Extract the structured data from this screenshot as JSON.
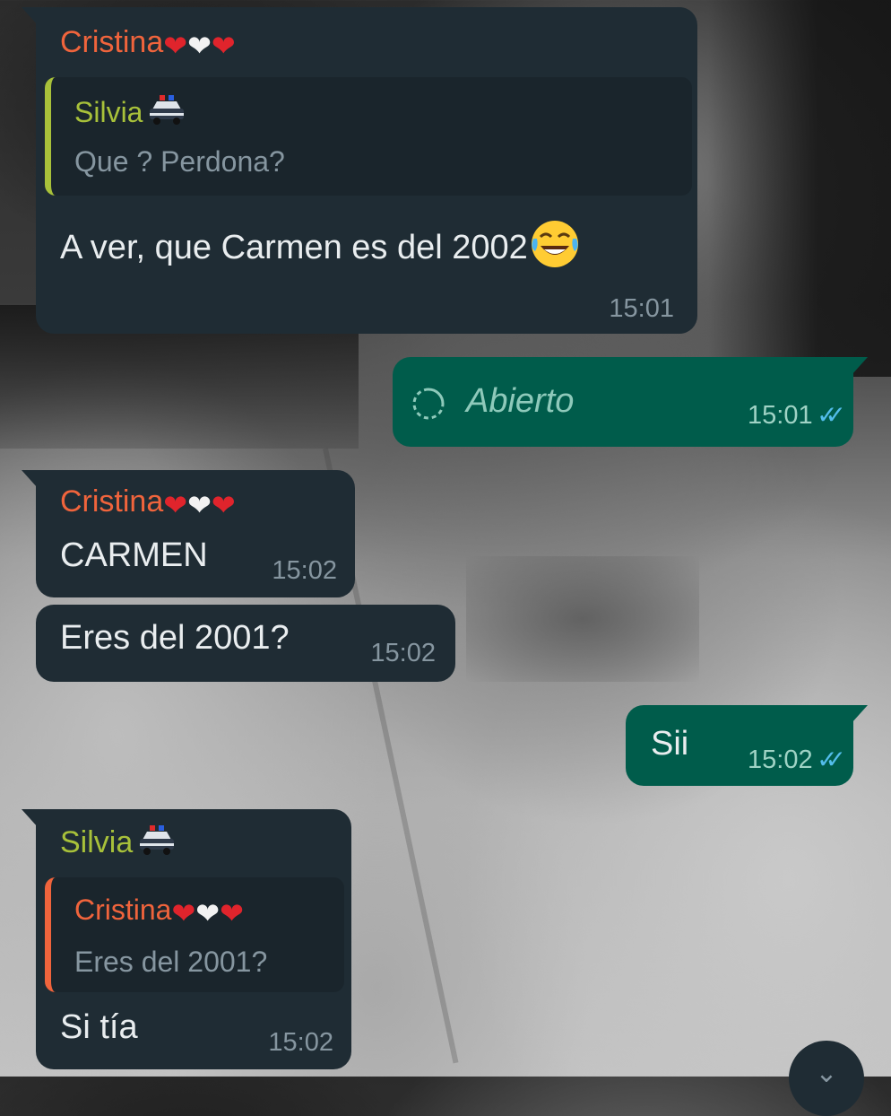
{
  "messages": [
    {
      "sender": "Cristina",
      "quote": {
        "sender": "Silvia",
        "text": "Que ? Perdona?"
      },
      "text": "A ver, que Carmen es del 2002",
      "time": "15:01"
    },
    {
      "text": "Abierto",
      "time": "15:01"
    },
    {
      "sender": "Cristina",
      "text": "CARMEN",
      "time": "15:02"
    },
    {
      "text": "Eres del 2001?",
      "time": "15:02"
    },
    {
      "text": "Sii",
      "time": "15:02"
    },
    {
      "sender": "Silvia",
      "quote": {
        "sender": "Cristina",
        "text": "Eres del 2001?"
      },
      "text": "Si tía",
      "time": "15:02"
    }
  ],
  "icons": {
    "hearts": [
      "red-heart-icon",
      "white-heart-icon",
      "red-heart-icon"
    ],
    "police_car": "police-car-icon",
    "laughing": "tears-of-joy-icon",
    "view_once": "view-once-icon",
    "read_receipt": "double-check-icon",
    "scroll_down": "chevron-down-icon"
  },
  "colors": {
    "incoming_bubble": "#1f2c34",
    "outgoing_bubble": "#005c4b",
    "cristina_name": "#f0643c",
    "silvia_name": "#a8c13a",
    "read_ticks": "#53bdeb"
  }
}
